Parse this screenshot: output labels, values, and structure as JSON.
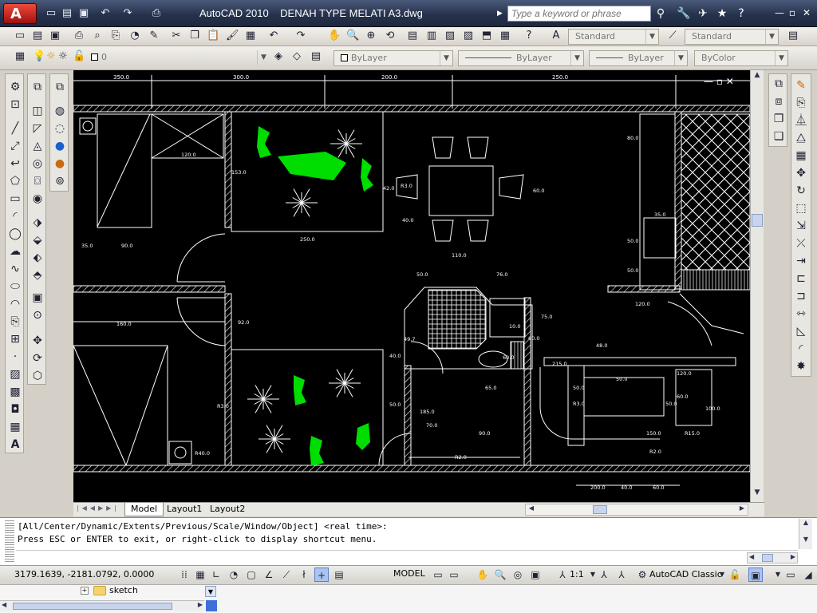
{
  "app": {
    "title": "AutoCAD 2010    DENAH TYPE MELATI A3.dwg",
    "search_placeholder": "Type a keyword or phrase",
    "logo_letter": "A"
  },
  "toolbars": {
    "styles": {
      "text_style": "Standard",
      "dim_style": "Standard"
    },
    "layers": {
      "current_layer": "0",
      "color": "ByLayer",
      "linetype": "ByLayer",
      "lineweight": "ByLayer",
      "plot_style": "ByColor"
    }
  },
  "viewport_tabs": [
    "Model",
    "Layout1",
    "Layout2"
  ],
  "command_line": {
    "line1": "[All/Center/Dynamic/Extents/Previous/Scale/Window/Object] <real time>:",
    "line2": "Press ESC or ENTER to exit, or right-click to display shortcut menu."
  },
  "status": {
    "coordinates": "3179.1639, -2181.0792, 0.0000",
    "model_label": "MODEL",
    "scale": "1:1",
    "workspace": "AutoCAD Classic"
  },
  "task_pane": {
    "folder": "sketch"
  },
  "drawing": {
    "dims_top": [
      "350.0",
      "300.0",
      "200.0",
      "250.0"
    ],
    "dims": [
      "120.0",
      "153.0",
      "250.0",
      "35.0",
      "90.0",
      "42.0",
      "R3.0",
      "40.0",
      "60.0",
      "110.0",
      "80.0",
      "35.0",
      "50.0",
      "50.0",
      "50.0",
      "76.0",
      "160.0",
      "92.0",
      "120.0",
      "75.0",
      "10.0",
      "60.0",
      "40.0",
      "65.0",
      "48.0",
      "215.0",
      "50.0",
      "50.0",
      "120.0",
      "60.0",
      "R3.0",
      "50.0",
      "100.0",
      "50.0",
      "185.0",
      "70.0",
      "90.0",
      "150.0",
      "R15.0",
      "R2.0",
      "R2.0",
      "R3.0",
      "R40.0",
      "200.0",
      "40.0",
      "60.0",
      "60.0",
      "49.7"
    ]
  },
  "colors": {
    "canvas": "#000000",
    "lines": "#ffffff",
    "trees": "#00dd00",
    "title_bar": "#27334d"
  }
}
